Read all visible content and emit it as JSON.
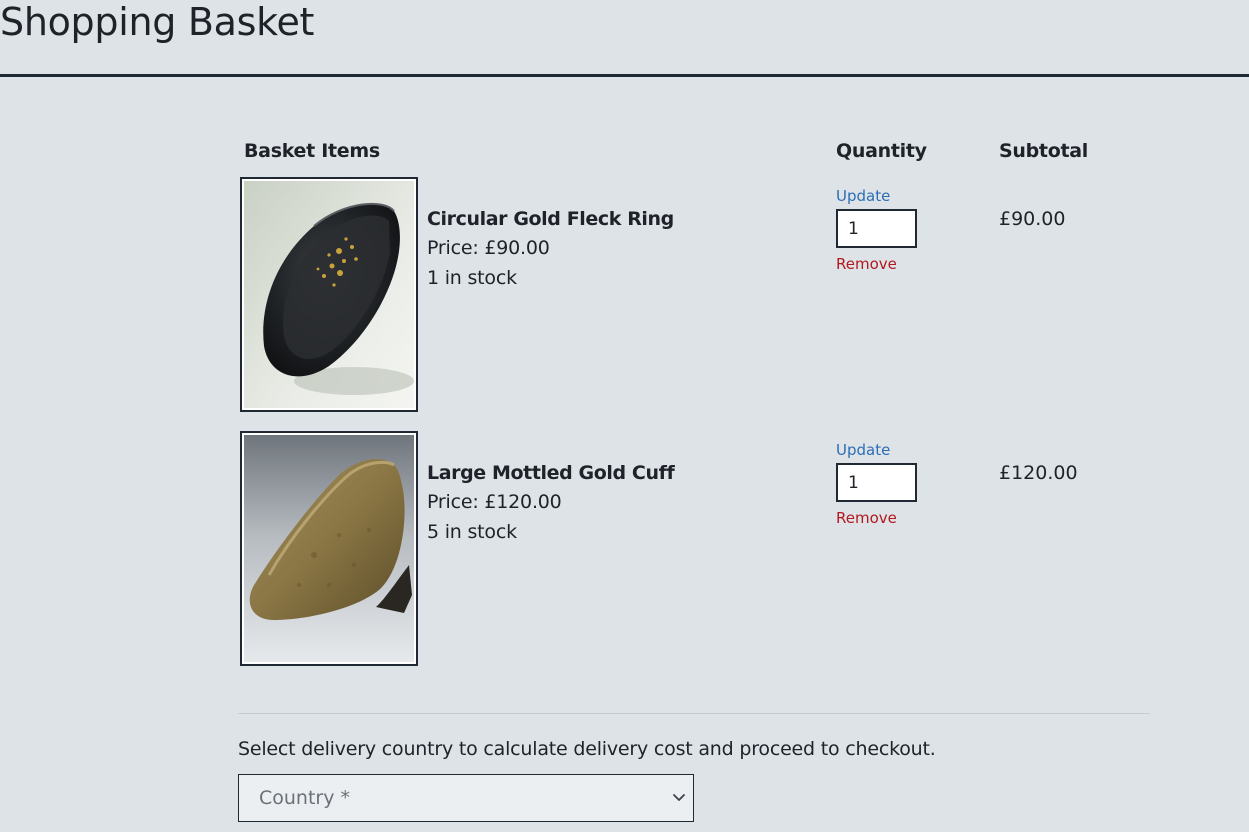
{
  "page": {
    "title": "Shopping Basket"
  },
  "basket": {
    "headers": {
      "items": "Basket Items",
      "quantity": "Quantity",
      "subtotal": "Subtotal"
    },
    "items": [
      {
        "name": "Circular Gold Fleck Ring",
        "price": "Price: £90.00",
        "stock": "1 in stock",
        "update_label": "Update",
        "quantity": "1",
        "remove_label": "Remove",
        "subtotal": "£90.00",
        "image_icon": "ring-photo"
      },
      {
        "name": "Large Mottled Gold Cuff",
        "price": "Price: £120.00",
        "stock": "5 in stock",
        "update_label": "Update",
        "quantity": "1",
        "remove_label": "Remove",
        "subtotal": "£120.00",
        "image_icon": "cuff-photo"
      }
    ]
  },
  "delivery": {
    "instruction": "Select delivery country to calculate delivery cost and proceed to checkout.",
    "country_placeholder": "Country *",
    "select_icon": "chevron-down-icon"
  },
  "colors": {
    "background": "#dee3e8",
    "text": "#1f2329",
    "update_link": "#2d6db5",
    "remove_link": "#b0191e"
  }
}
